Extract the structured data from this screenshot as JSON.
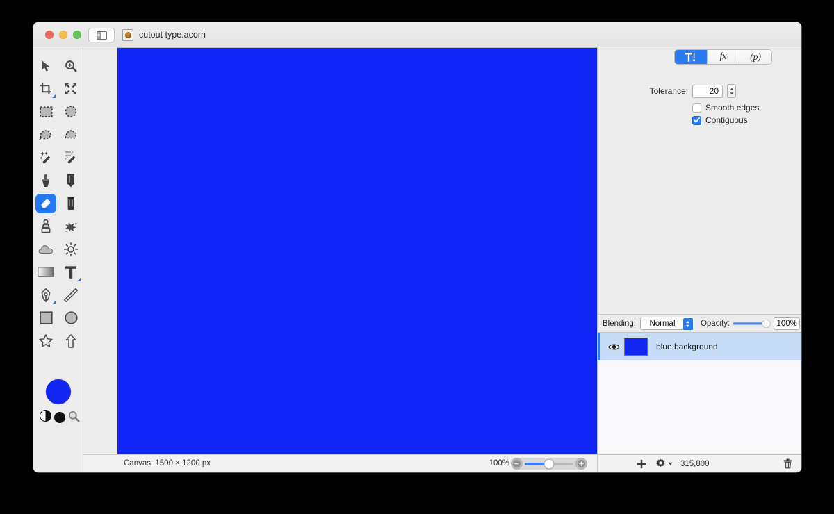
{
  "window": {
    "title": "cutout type.acorn",
    "doc_icon": "acorn-document-icon",
    "sidebar_toggle_icon": "sidebar-panel-icon"
  },
  "traffic_lights": [
    {
      "name": "close",
      "color": "#ed6a5f"
    },
    {
      "name": "minimize",
      "color": "#f5bf4f"
    },
    {
      "name": "zoom",
      "color": "#61c454"
    }
  ],
  "tools": [
    {
      "name": "move-tool",
      "icon": "arrow-cursor-icon",
      "selected": false,
      "badge": false
    },
    {
      "name": "zoom-tool",
      "icon": "magnifier-plus-icon",
      "selected": false,
      "badge": false
    },
    {
      "name": "crop-tool",
      "icon": "crop-icon",
      "selected": false,
      "badge": true
    },
    {
      "name": "transform-tool",
      "icon": "move-arrows-icon",
      "selected": false,
      "badge": false
    },
    {
      "name": "rectangular-selection-tool",
      "icon": "dashed-rectangle-icon",
      "selected": false,
      "badge": false
    },
    {
      "name": "elliptical-selection-tool",
      "icon": "dashed-ellipse-icon",
      "selected": false,
      "badge": false
    },
    {
      "name": "lasso-tool",
      "icon": "lasso-icon",
      "selected": false,
      "badge": false
    },
    {
      "name": "polygonal-lasso-tool",
      "icon": "polygon-lasso-icon",
      "selected": false,
      "badge": false
    },
    {
      "name": "magic-wand-tool",
      "icon": "magic-wand-icon",
      "selected": false,
      "badge": false
    },
    {
      "name": "instant-alpha-tool",
      "icon": "magic-wand-dotted-icon",
      "selected": false,
      "badge": false
    },
    {
      "name": "paint-bucket-tool",
      "icon": "paint-bucket-icon",
      "selected": false,
      "badge": false
    },
    {
      "name": "pencil-tool",
      "icon": "pencil-icon",
      "selected": false,
      "badge": false
    },
    {
      "name": "eraser-tool",
      "icon": "eraser-icon",
      "selected": true,
      "badge": false
    },
    {
      "name": "marker-tool",
      "icon": "marker-icon",
      "selected": false,
      "badge": false
    },
    {
      "name": "clone-stamp-tool",
      "icon": "clone-stamp-icon",
      "selected": false,
      "badge": false
    },
    {
      "name": "smudge-tool",
      "icon": "smudge-splat-icon",
      "selected": false,
      "badge": false
    },
    {
      "name": "blur-tool",
      "icon": "cloud-icon",
      "selected": false,
      "badge": false
    },
    {
      "name": "dodge-tool",
      "icon": "sun-icon",
      "selected": false,
      "badge": false
    },
    {
      "name": "gradient-tool",
      "icon": "gradient-icon",
      "selected": false,
      "badge": false
    },
    {
      "name": "text-tool",
      "icon": "text-t-icon",
      "selected": false,
      "badge": true
    },
    {
      "name": "pen-tool",
      "icon": "pen-nib-icon",
      "selected": false,
      "badge": true
    },
    {
      "name": "line-tool",
      "icon": "line-icon",
      "selected": false,
      "badge": false
    },
    {
      "name": "rectangle-shape-tool",
      "icon": "rectangle-icon",
      "selected": false,
      "badge": false
    },
    {
      "name": "ellipse-shape-tool",
      "icon": "ellipse-icon",
      "selected": false,
      "badge": false
    },
    {
      "name": "star-shape-tool",
      "icon": "star-icon",
      "selected": false,
      "badge": false
    },
    {
      "name": "arrow-shape-tool",
      "icon": "up-arrow-icon",
      "selected": false,
      "badge": false
    }
  ],
  "colors": {
    "foreground": "#1226f2",
    "background": "#111111",
    "canvas_fill": "#0f25f5",
    "accent": "#2b7cf0",
    "layer_selection": "#c7ddf7"
  },
  "color_wells": {
    "foreground_name": "foreground-color-well",
    "swap_name": "swap-colors-icon",
    "black_name": "default-black-color-well",
    "picker_name": "color-picker-magnifier-icon"
  },
  "canvas": {
    "fill": "#0f25f5"
  },
  "statusbar": {
    "canvas_size": "Canvas: 1500 × 1200 px",
    "zoom_level": "100%",
    "zoom_out_icon": "minus-circle-icon",
    "zoom_in_icon": "plus-circle-icon",
    "slider_position_pct": 50
  },
  "inspector": {
    "segments": [
      {
        "name": "tool-options-segment",
        "label": "",
        "icon": "tool-options-icon",
        "active": true
      },
      {
        "name": "filters-segment",
        "label": "fx",
        "icon": "fx-icon",
        "active": false
      },
      {
        "name": "presets-segment",
        "label": "(p)",
        "icon": "presets-icon",
        "active": false
      }
    ],
    "tolerance_label": "Tolerance:",
    "tolerance_value": "20",
    "stepper_icon": "stepper-up-down-icon",
    "checkboxes": [
      {
        "name": "smooth-edges-checkbox",
        "label": "Smooth edges",
        "checked": false
      },
      {
        "name": "contiguous-checkbox",
        "label": "Contiguous",
        "checked": true
      }
    ]
  },
  "layers_panel": {
    "blending_label": "Blending:",
    "blending_value": "Normal",
    "opacity_label": "Opacity:",
    "opacity_value": "100%",
    "opacity_pct": 100,
    "rows": [
      {
        "name": "blue background",
        "visible": true,
        "selected": true,
        "thumb_color": "#1226f2",
        "eye_icon": "eye-icon"
      }
    ],
    "toolbar": {
      "add_icon": "plus-icon",
      "gear_icon": "gear-icon",
      "gear_arrow_icon": "chevron-down-icon",
      "count": "315,800",
      "trash_icon": "trash-icon"
    }
  }
}
